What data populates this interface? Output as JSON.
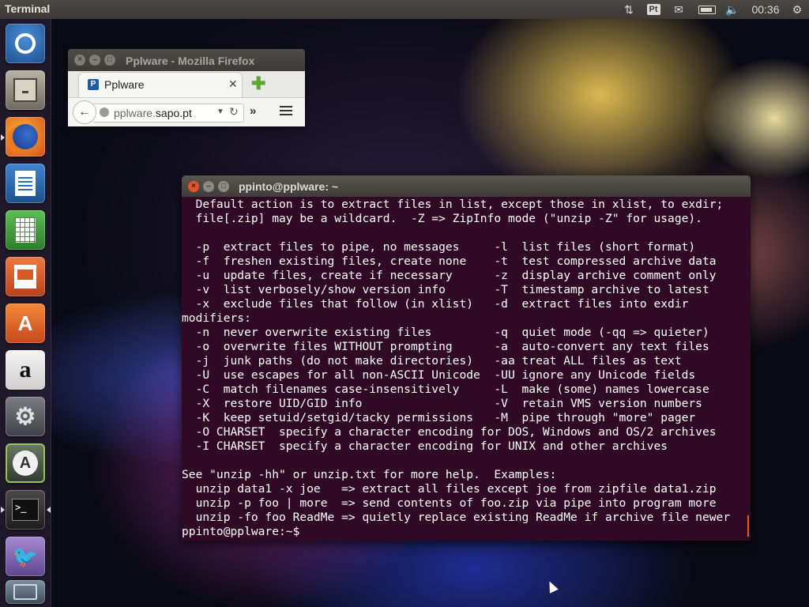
{
  "top_panel": {
    "title": "Terminal",
    "keyboard_layout": "Pt",
    "clock": "00:36"
  },
  "launcher": {
    "items": [
      {
        "name": "dash-home",
        "icon": "ubuntu-logo-icon",
        "color": "#2b6fb8"
      },
      {
        "name": "files",
        "icon": "file-cabinet-icon",
        "color": "#8a8478"
      },
      {
        "name": "firefox",
        "icon": "firefox-icon",
        "color": "#e66a16"
      },
      {
        "name": "libreoffice-writer",
        "icon": "writer-document-icon",
        "color": "#2a6fb4"
      },
      {
        "name": "libreoffice-calc",
        "icon": "calc-spreadsheet-icon",
        "color": "#3b9b3a"
      },
      {
        "name": "libreoffice-impress",
        "icon": "impress-presentation-icon",
        "color": "#d65a26"
      },
      {
        "name": "ubuntu-software-center",
        "icon": "shopping-bag-icon",
        "color": "#e0642a"
      },
      {
        "name": "amazon",
        "icon": "amazon-icon",
        "color": "#e8e8e8"
      },
      {
        "name": "system-settings",
        "icon": "wrench-gear-icon",
        "color": "#5d5f64"
      },
      {
        "name": "software-updater",
        "icon": "update-icon",
        "color": "#4c5a4a"
      },
      {
        "name": "terminal",
        "icon": "terminal-icon",
        "color": "#2b2b2b"
      },
      {
        "name": "pidgin",
        "icon": "pidgin-bird-icon",
        "color": "#8a6fb0"
      },
      {
        "name": "trash",
        "icon": "trash-icon",
        "color": "#5a6a78"
      }
    ]
  },
  "firefox": {
    "window_title": "Pplware - Mozilla Firefox",
    "tab_label": "Pplware",
    "tab_favicon": "P",
    "url_domain_prefix": "pplware.",
    "url_domain_main": "sapo.pt"
  },
  "terminal": {
    "window_title": "ppinto@pplware: ~",
    "lines": [
      "  Default action is to extract files in list, except those in xlist, to exdir;",
      "  file[.zip] may be a wildcard.  -Z => ZipInfo mode (\"unzip -Z\" for usage).",
      "",
      "  -p  extract files to pipe, no messages     -l  list files (short format)",
      "  -f  freshen existing files, create none    -t  test compressed archive data",
      "  -u  update files, create if necessary      -z  display archive comment only",
      "  -v  list verbosely/show version info       -T  timestamp archive to latest",
      "  -x  exclude files that follow (in xlist)   -d  extract files into exdir",
      "modifiers:",
      "  -n  never overwrite existing files         -q  quiet mode (-qq => quieter)",
      "  -o  overwrite files WITHOUT prompting      -a  auto-convert any text files",
      "  -j  junk paths (do not make directories)   -aa treat ALL files as text",
      "  -U  use escapes for all non-ASCII Unicode  -UU ignore any Unicode fields",
      "  -C  match filenames case-insensitively     -L  make (some) names lowercase",
      "  -X  restore UID/GID info                   -V  retain VMS version numbers",
      "  -K  keep setuid/setgid/tacky permissions   -M  pipe through \"more\" pager",
      "  -O CHARSET  specify a character encoding for DOS, Windows and OS/2 archives",
      "  -I CHARSET  specify a character encoding for UNIX and other archives",
      "",
      "See \"unzip -hh\" or unzip.txt for more help.  Examples:",
      "  unzip data1 -x joe   => extract all files except joe from zipfile data1.zip",
      "  unzip -p foo | more  => send contents of foo.zip via pipe into program more",
      "  unzip -fo foo ReadMe => quietly replace existing ReadMe if archive file newer",
      "ppinto@pplware:~$ "
    ]
  }
}
